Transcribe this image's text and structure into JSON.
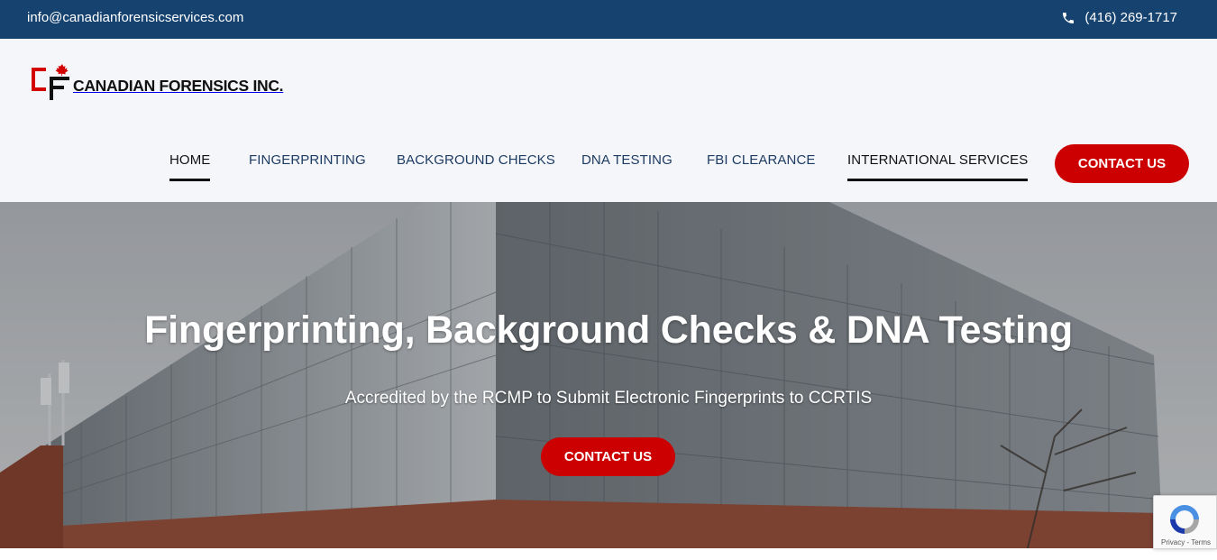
{
  "topbar": {
    "email": "info@canadianforensicservices.com",
    "phone": "(416) 269-1717",
    "phone_icon": "phone-icon"
  },
  "logo": {
    "text": "CANADIAN FORENSICS INC.",
    "mark_letters": "CF",
    "mark_icon": "maple-leaf-icon"
  },
  "nav": {
    "items": [
      {
        "label": "HOME",
        "active": true
      },
      {
        "label": "FINGERPRINTING",
        "active": false
      },
      {
        "label": "BACKGROUND CHECKS",
        "active": false
      },
      {
        "label": "DNA TESTING",
        "active": false
      },
      {
        "label": "FBI CLEARANCE",
        "active": false
      },
      {
        "label": "INTERNATIONAL SERVICES",
        "active": false
      }
    ],
    "contact_label": "CONTACT US"
  },
  "hero": {
    "title": "Fingerprinting, Background Checks & DNA Testing",
    "subtitle": "Accredited by the RCMP to Submit Electronic Fingerprints to CCRTIS",
    "cta_label": "CONTACT US"
  },
  "recaptcha": {
    "links": "Privacy - Terms",
    "icon": "recaptcha-icon"
  },
  "colors": {
    "topbar": "#16426f",
    "accent": "#cc0000",
    "nav_text": "#1d3c63",
    "header_bg": "#f5f6fa"
  }
}
